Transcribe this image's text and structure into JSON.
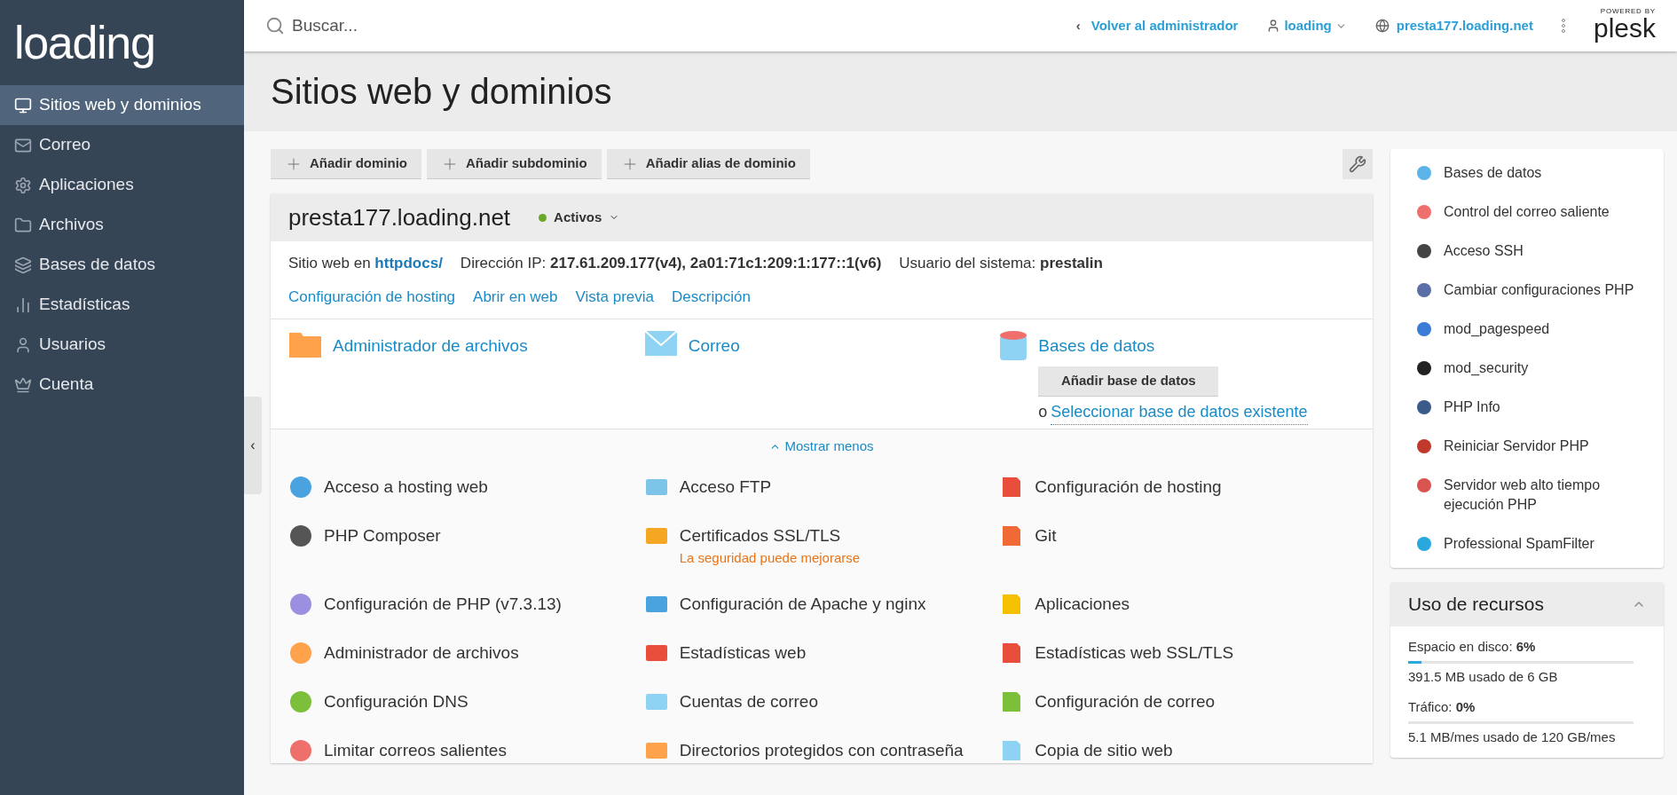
{
  "sidebar": {
    "logo": "loading",
    "items": [
      {
        "label": "Sitios web y dominios",
        "selected": true
      },
      {
        "label": "Correo",
        "selected": false
      },
      {
        "label": "Aplicaciones",
        "selected": false
      },
      {
        "label": "Archivos",
        "selected": false
      },
      {
        "label": "Bases de datos",
        "selected": false
      },
      {
        "label": "Estadísticas",
        "selected": false
      },
      {
        "label": "Usuarios",
        "selected": false
      },
      {
        "label": "Cuenta",
        "selected": false
      }
    ],
    "collapse": "‹"
  },
  "topbar": {
    "search": {
      "placeholder": "Buscar..."
    },
    "back": "Volver al administrador",
    "back_arrow": "‹",
    "user": "loading",
    "domain": "presta177.loading.net",
    "brand_small": "POWERED BY",
    "brand": "plesk"
  },
  "page_title": "Sitios web y dominios",
  "actions": [
    "Añadir dominio",
    "Añadir subdominio",
    "Añadir alias de dominio"
  ],
  "domain": {
    "name": "presta177.loading.net",
    "status": "Activos",
    "status_dot": {
      "color": "#6aa829"
    },
    "info": [
      {
        "label": "Sitio web en",
        "value": "httpdocs/",
        "kind": "link"
      },
      {
        "label": "Dirección IP:",
        "value": "217.61.209.177(v4), 2a01:71c1:209:1:177::1(v6)",
        "kind": "bold"
      },
      {
        "label": "Usuario del sistema:",
        "value": "prestalin",
        "kind": "bold"
      }
    ],
    "links": [
      "Configuración de hosting",
      "Abrir en web",
      "Vista previa",
      "Descripción"
    ],
    "quick": [
      {
        "label": "Administrador de archivos",
        "kind": "folder"
      },
      {
        "label": "Correo",
        "kind": "mail"
      },
      {
        "label": "Bases de datos",
        "kind": "db",
        "button": "Añadir base de datos",
        "or": "o",
        "link": "Seleccionar base de datos existente"
      }
    ],
    "toggle": "Mostrar menos",
    "tools": [
      {
        "label": "Acceso a hosting web"
      },
      {
        "label": "Acceso FTP"
      },
      {
        "label": "Configuración de hosting"
      },
      {
        "label": "PHP Composer"
      },
      {
        "label": "Certificados SSL/TLS",
        "note": "La seguridad puede mejorarse"
      },
      {
        "label": "Git"
      },
      {
        "label": "Configuración de PHP (v7.3.13)"
      },
      {
        "label": "Configuración de Apache y nginx"
      },
      {
        "label": "Aplicaciones"
      },
      {
        "label": "Administrador de archivos"
      },
      {
        "label": "Estadísticas web"
      },
      {
        "label": "Estadísticas web SSL/TLS"
      },
      {
        "label": "Configuración DNS"
      },
      {
        "label": "Cuentas de correo"
      },
      {
        "label": "Configuración de correo"
      },
      {
        "label": "Limitar correos salientes"
      },
      {
        "label": "Directorios protegidos con contraseña"
      },
      {
        "label": "Copia de sitio web"
      }
    ]
  },
  "side_panel": {
    "links": [
      "Bases de datos",
      "Control del correo saliente",
      "Acceso SSH",
      "Cambiar configuraciones PHP",
      "mod_pagespeed",
      "mod_security",
      "PHP Info",
      "Reiniciar Servidor PHP",
      "Servidor web alto tiempo ejecución PHP",
      "Professional SpamFilter"
    ],
    "resources": {
      "title": "Uso de recursos",
      "expanded": true,
      "items": [
        {
          "label": "Espacio en disco:",
          "value": "6%",
          "level": 0.06,
          "detail": "391.5 MB usado de 6 GB"
        },
        {
          "label": "Tráfico:",
          "value": "0%",
          "level": 0,
          "detail": "5.1 MB/mes usado de 120 GB/mes"
        }
      ]
    }
  }
}
